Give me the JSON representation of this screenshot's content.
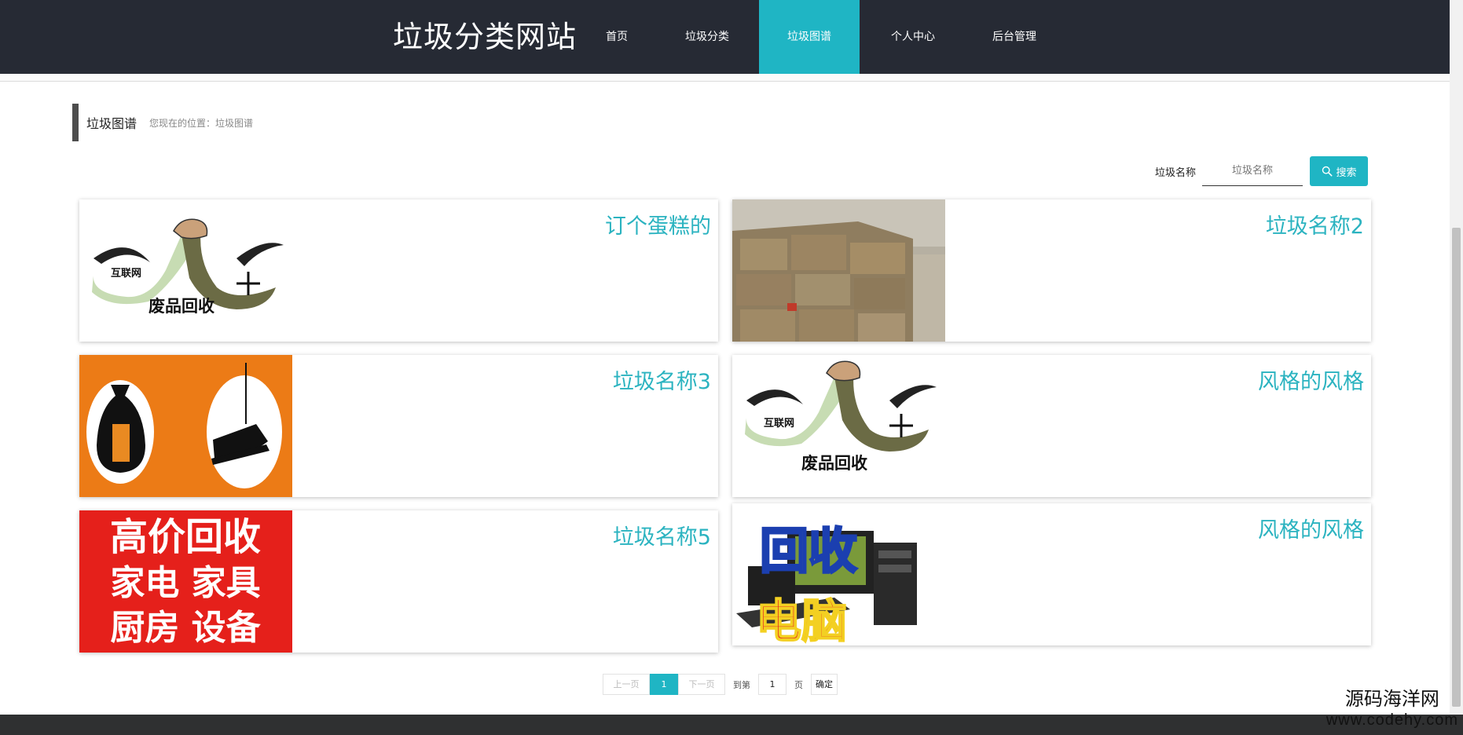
{
  "header": {
    "title": "垃圾分类网站",
    "nav": [
      {
        "label": "首页",
        "active": false
      },
      {
        "label": "垃圾分类",
        "active": false
      },
      {
        "label": "垃圾图谱",
        "active": true
      },
      {
        "label": "个人中心",
        "active": false
      },
      {
        "label": "后台管理",
        "active": false
      }
    ]
  },
  "breadcrumb": {
    "title": "垃圾图谱",
    "location": "您现在的位置：垃圾图谱"
  },
  "search": {
    "label": "垃圾名称",
    "placeholder": "垃圾名称",
    "button_label": "搜索",
    "button_icon": "search-icon"
  },
  "cards": [
    {
      "title": "订个蛋糕的",
      "image": "recycle-logo"
    },
    {
      "title": "垃圾名称2",
      "image": "cardboard-bales-photo"
    },
    {
      "title": "垃圾名称3",
      "image": "bag-and-shoe-icons"
    },
    {
      "title": "风格的风格",
      "image": "recycle-logo"
    },
    {
      "title": "垃圾名称5",
      "image": "recycle-ad-banner"
    },
    {
      "title": "风格的风格",
      "image": "computer-recycling"
    }
  ],
  "images": {
    "recycle_logo": {
      "brand": "互联网",
      "plus": "+",
      "caption": "废品回收"
    },
    "ad_banner": {
      "lines": [
        "高价回收",
        "家电 家具",
        "厨房 设备"
      ]
    },
    "computer": {
      "line1": "回收",
      "line2": "电脑"
    }
  },
  "pagination": {
    "prev": "上一页",
    "current": "1",
    "next": "下一页",
    "goto_label": "到第",
    "page_value": "1",
    "page_unit": "页",
    "confirm": "确定"
  },
  "watermark": {
    "name": "源码海洋网",
    "url": "www.codehy.com"
  },
  "colors": {
    "header_bg": "#262a34",
    "accent": "#1fb5c4",
    "card_title": "#2bb3c0",
    "footer_bg": "#2f3031"
  }
}
